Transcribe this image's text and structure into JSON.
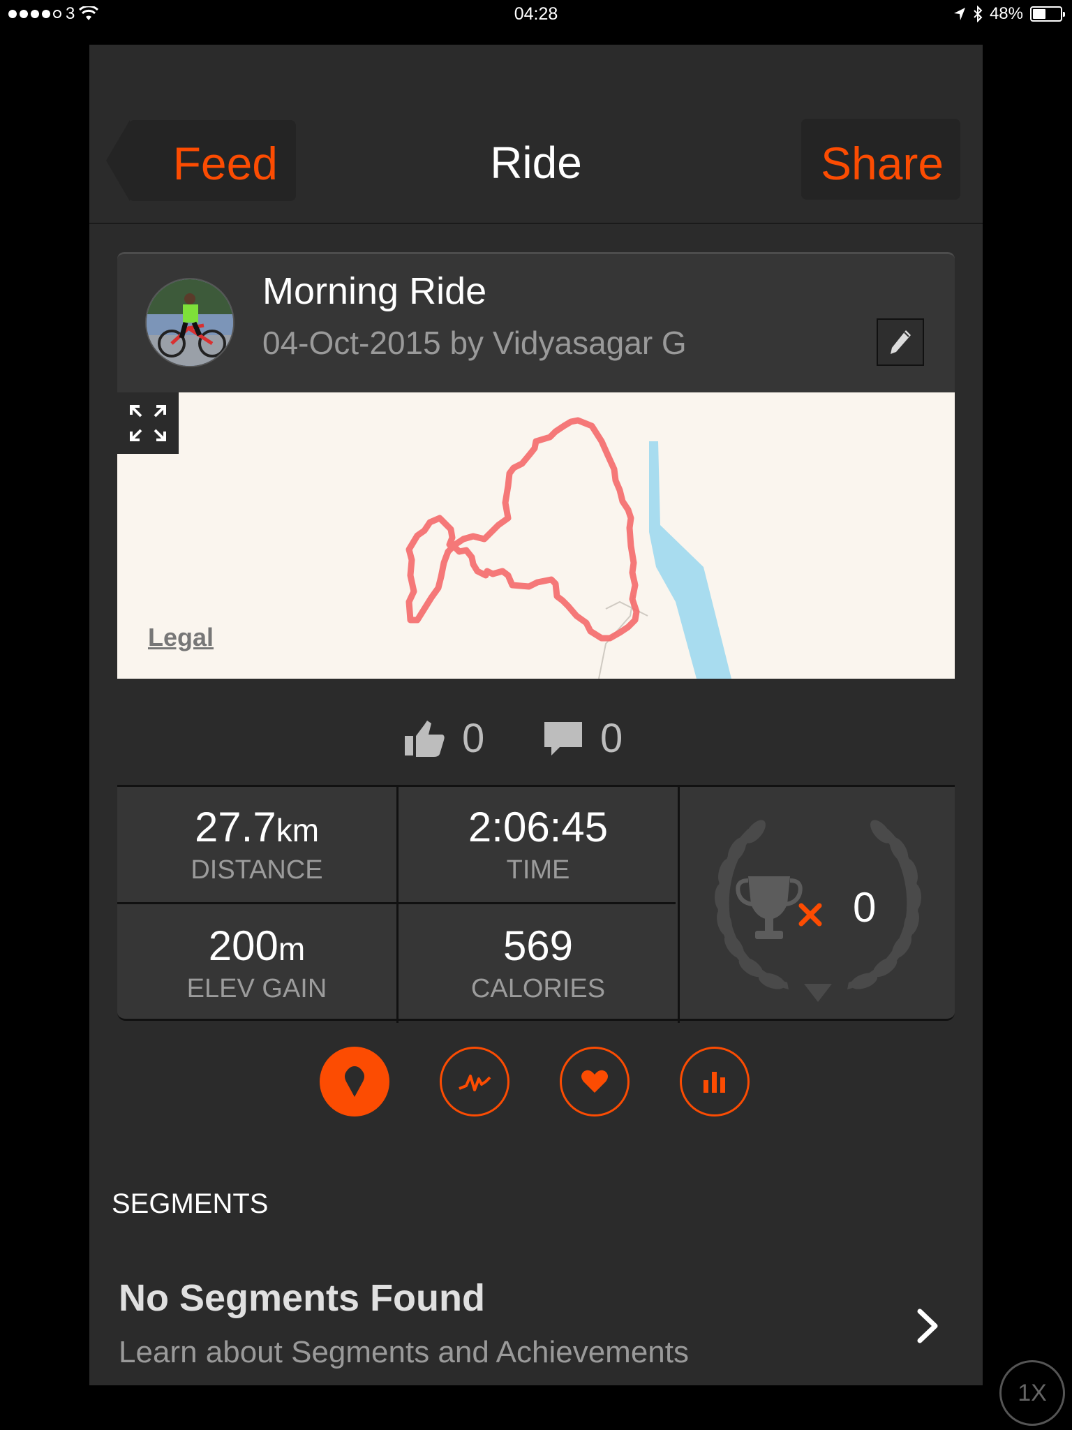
{
  "status_bar": {
    "carrier": "3",
    "time": "04:28",
    "battery": "48%",
    "battery_level": 0.48
  },
  "nav": {
    "back_label": "Feed",
    "title": "Ride",
    "share_label": "Share"
  },
  "activity": {
    "title": "Morning Ride",
    "subtitle": "04-Oct-2015 by Vidyasagar G",
    "map_legal": "Legal"
  },
  "social": {
    "kudos_count": "0",
    "comment_count": "0"
  },
  "stats": {
    "distance_value": "27.7",
    "distance_unit": "km",
    "distance_label": "DISTANCE",
    "time_value": "2:06:45",
    "time_label": "TIME",
    "elev_value": "200",
    "elev_unit": "m",
    "elev_label": "ELEV GAIN",
    "calories_value": "569",
    "calories_label": "CALORIES",
    "achievements_count": "0"
  },
  "tabs": [
    "map-tab",
    "analysis-tab",
    "heartrate-tab",
    "splits-tab"
  ],
  "segments": {
    "header": "SEGMENTS",
    "empty_title": "No Segments Found",
    "empty_subtitle": "Learn about Segments and Achievements"
  },
  "zoom_badge": "1X",
  "colors": {
    "accent": "#fc4c02",
    "background": "#2b2b2b",
    "card": "#363636",
    "route": "#f46a6a",
    "water": "#a8dcef"
  }
}
